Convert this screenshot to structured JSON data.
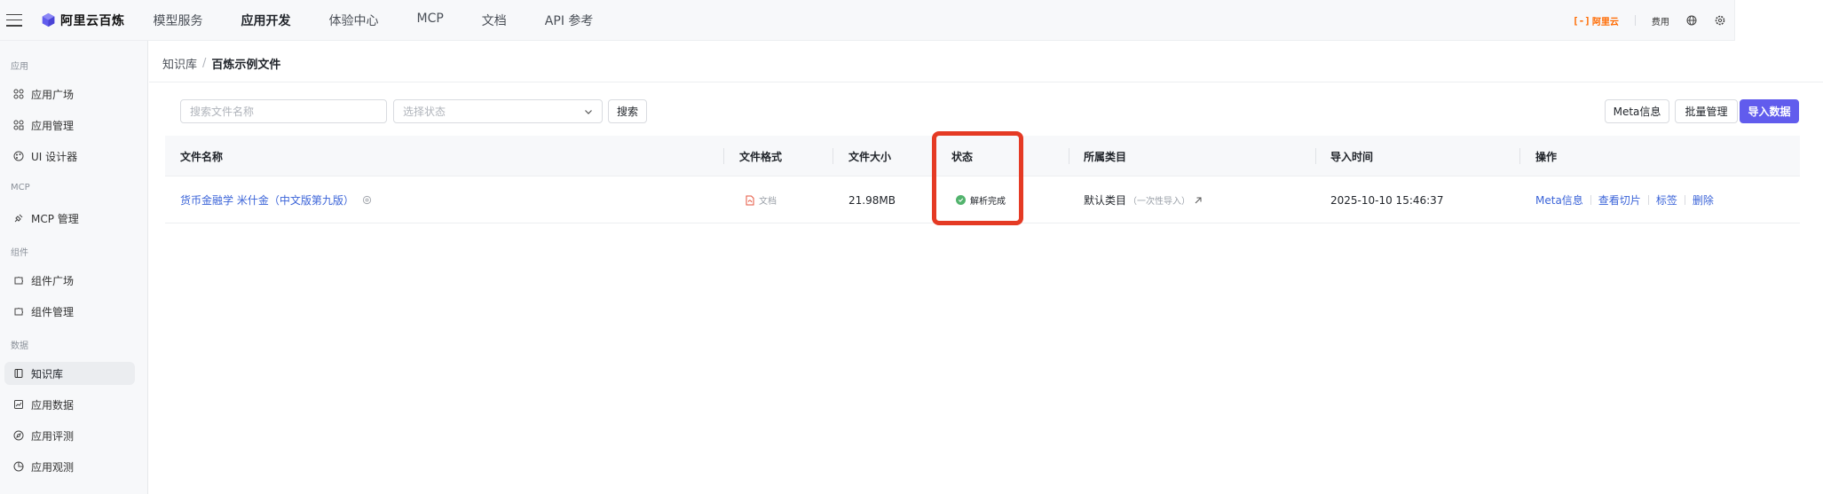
{
  "header": {
    "brand": "阿里云百炼",
    "nav": [
      {
        "label": "模型服务",
        "active": false
      },
      {
        "label": "应用开发",
        "active": true
      },
      {
        "label": "体验中心",
        "active": false
      },
      {
        "label": "MCP",
        "active": false
      },
      {
        "label": "文档",
        "active": false
      },
      {
        "label": "API 参考",
        "active": false
      }
    ],
    "promo": "阿里云",
    "promo_bracket": "[-]",
    "billing": "费用"
  },
  "sidebar": {
    "sections": [
      {
        "label": "应用",
        "items": [
          {
            "label": "应用广场",
            "icon": "grid-icon"
          },
          {
            "label": "应用管理",
            "icon": "grid-icon"
          },
          {
            "label": "UI 设计器",
            "icon": "palette-icon"
          }
        ]
      },
      {
        "label": "MCP",
        "items": [
          {
            "label": "MCP 管理",
            "icon": "plug-icon"
          }
        ]
      },
      {
        "label": "组件",
        "items": [
          {
            "label": "组件广场",
            "icon": "puzzle-icon"
          },
          {
            "label": "组件管理",
            "icon": "puzzle-icon"
          }
        ]
      },
      {
        "label": "数据",
        "items": [
          {
            "label": "知识库",
            "icon": "book-icon",
            "active": true
          },
          {
            "label": "应用数据",
            "icon": "chart-icon"
          },
          {
            "label": "应用评测",
            "icon": "compass-icon"
          },
          {
            "label": "应用观测",
            "icon": "pie-icon"
          }
        ]
      }
    ]
  },
  "breadcrumb": {
    "parent": "知识库",
    "separator": "/",
    "current": "百炼示例文件"
  },
  "toolbar": {
    "search_placeholder": "搜索文件名称",
    "status_placeholder": "选择状态",
    "search_button": "搜索",
    "meta_button": "Meta信息",
    "batch_button": "批量管理",
    "import_button": "导入数据"
  },
  "table": {
    "columns": [
      "文件名称",
      "文件格式",
      "文件大小",
      "状态",
      "所属类目",
      "导入时间",
      "操作"
    ],
    "rows": [
      {
        "name": "货币金融学 米什金（中文版第九版）",
        "format": "文档",
        "size": "21.98MB",
        "status": "解析完成",
        "category": "默认类目",
        "category_note": "（一次性导入）",
        "time": "2025-10-10 15:46:37",
        "actions": [
          "Meta信息",
          "查看切片",
          "标签",
          "删除"
        ]
      }
    ]
  },
  "colors": {
    "accent": "#615ced",
    "link": "#3a63d8",
    "success": "#52b36d",
    "highlight": "#e53a24",
    "promo": "#ff6a00"
  }
}
